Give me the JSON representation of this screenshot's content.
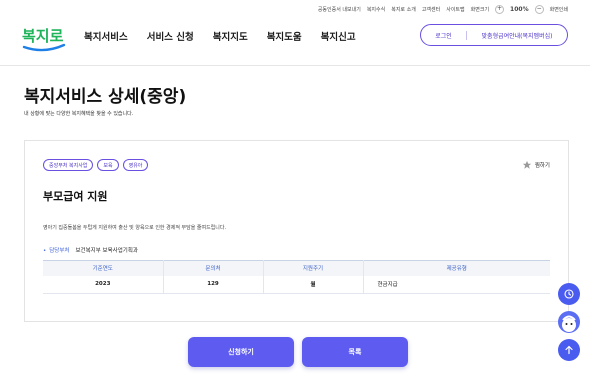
{
  "util_links": [
    "공동인증서 내보내기",
    "복지수식",
    "복지로 소개",
    "고객센터",
    "사이트맵",
    "화면크기"
  ],
  "zoom": {
    "minus": "−",
    "plus": "+",
    "value": "100%"
  },
  "util_reset": "화면인쇄",
  "logo_text": "복지로",
  "nav": [
    "복지서비스",
    "서비스 신청",
    "복지지도",
    "복지도움",
    "복지신고"
  ],
  "header_buttons": {
    "login": "로그인",
    "guide": "맞춤형급여안내(복지멤버십)"
  },
  "page": {
    "title": "복지서비스 상세(중앙)",
    "description": "내 상황에 맞는 다양한 복지혜택을 찾을 수 있습니다."
  },
  "service": {
    "tags": [
      "중앙부처 복지사업",
      "보육",
      "영유아"
    ],
    "bookmark_label": "찜하기",
    "name": "부모급여 지원",
    "description": "영아기 집중돌봄을 두텁게 지원하여 출산 및 양육으로 인한 경제적 부담을 줄여드립니다.",
    "dept_label": "담당부처",
    "dept_value": "보건복지부 보육사업기획과",
    "table": {
      "headers": [
        "기준연도",
        "문의처",
        "지원주기",
        "제공유형"
      ],
      "rows": [
        [
          "2023",
          "129",
          "월",
          "현금지급"
        ]
      ]
    }
  },
  "actions": {
    "apply": "신청하기",
    "list": "목록"
  },
  "colors": {
    "primary": "#5e5cf0",
    "accent": "#4a32c8",
    "logo_green": "#1fb35a"
  }
}
